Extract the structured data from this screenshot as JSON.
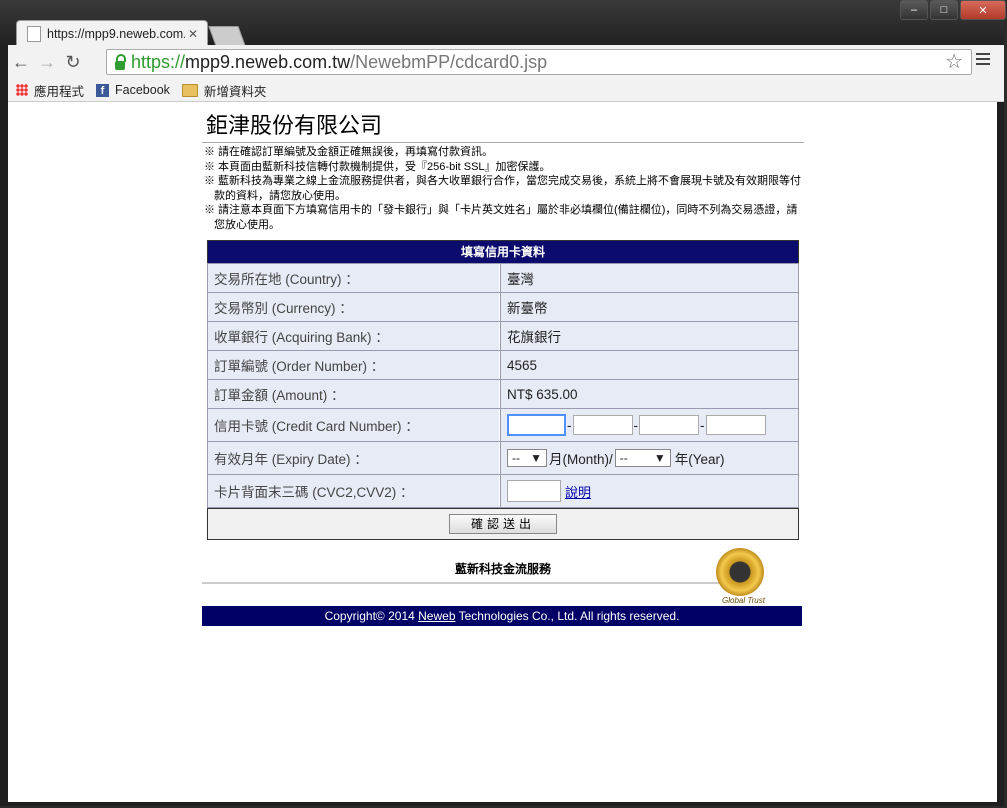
{
  "browser": {
    "tab_title": "https://mpp9.neweb.com.tw",
    "url_scheme": "https://",
    "url_host": "mpp9.neweb.com.tw",
    "url_path": "/NewebmPP/cdcard0.jsp",
    "bookmarks": [
      "應用程式",
      "Facebook",
      "新增資料夾"
    ]
  },
  "page": {
    "company": "鉅津股份有限公司",
    "notes": [
      "※ 請在確認訂單編號及金額正確無誤後，再填寫付款資訊。",
      "※ 本頁面由藍新科技信轉付款機制提供，受『256-bit SSL』加密保護。",
      "※ 藍新科技為專業之線上金流服務提供者，與各大收單銀行合作，當您完成交易後，系統上將不會展現卡號及有效期限等付款的資料，請您放心使用。",
      "※ 請注意本頁面下方填寫信用卡的「發卡銀行」與「卡片英文姓名」屬於非必填欄位(備註欄位)，同時不列為交易憑證，請您放心使用。"
    ],
    "form_title": "填寫信用卡資料",
    "rows": [
      {
        "label": "交易所在地 (Country) ：",
        "value": "臺灣"
      },
      {
        "label": "交易幣別 (Currency) ：",
        "value": "新臺幣"
      },
      {
        "label": "收單銀行 (Acquiring Bank) ：",
        "value": "花旗銀行"
      },
      {
        "label": "訂單編號 (Order Number) ：",
        "value": "4565"
      },
      {
        "label": "訂單金額 (Amount) ：",
        "value": "NT$ 635.00"
      }
    ],
    "card_label": "信用卡號 (Credit Card Number) ：",
    "card_separator": "-",
    "expiry_label": "有效月年 (Expiry Date) ：",
    "month_value": "--",
    "month_text": "月(Month)/",
    "year_value": "--",
    "year_text": "年(Year)",
    "cvc_label": "卡片背面末三碼 (CVC2,CVV2) ：",
    "cvc_help": "說明",
    "submit_label": "確認送出",
    "service": "藍新科技金流服務",
    "seal_text": "Global Trust",
    "footer_prefix": "Copyright© 2014 ",
    "footer_link": "Neweb",
    "footer_suffix": " Technologies Co., Ltd. All rights reserved."
  }
}
